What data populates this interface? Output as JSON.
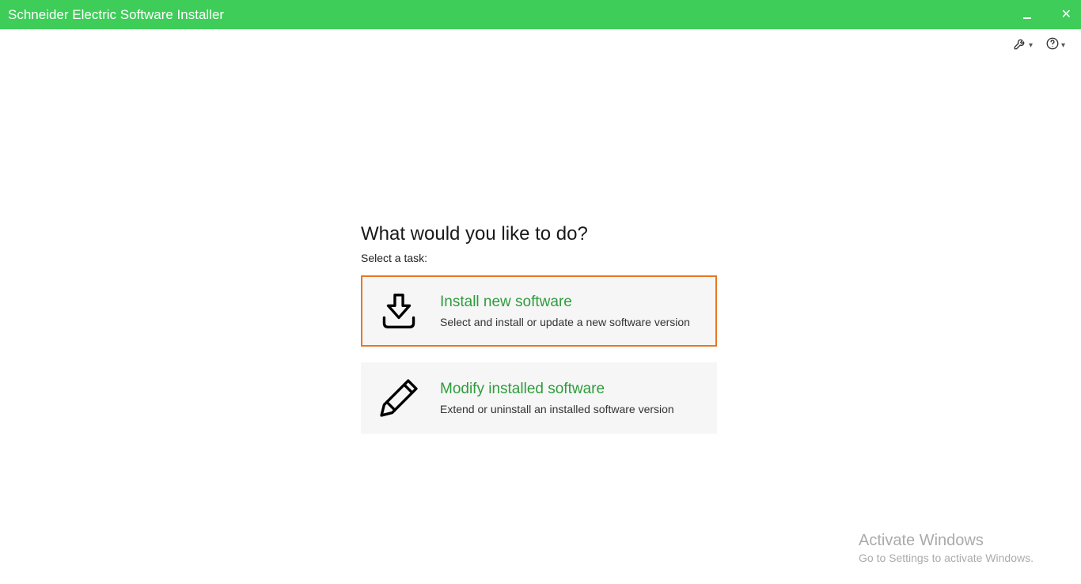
{
  "window": {
    "title": "Schneider Electric Software Installer"
  },
  "main": {
    "heading": "What would you like to do?",
    "subheading": "Select a task:",
    "options": [
      {
        "title": "Install new software",
        "desc": "Select and install or update a new software version"
      },
      {
        "title": "Modify installed software",
        "desc": "Extend or uninstall an installed software version"
      }
    ]
  },
  "watermark": {
    "line1": "Activate Windows",
    "line2": "Go to Settings to activate Windows."
  }
}
